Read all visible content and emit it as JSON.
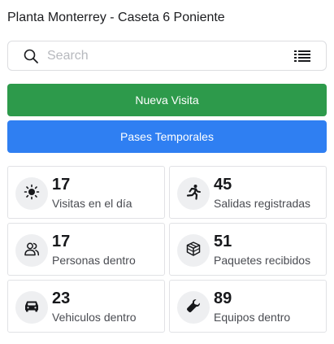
{
  "header": {
    "title": "Planta Monterrey - Caseta 6 Poniente"
  },
  "search": {
    "placeholder": "Search",
    "value": "",
    "icon": "search-icon",
    "list_icon": "list-icon"
  },
  "actions": {
    "new_visit_label": "Nueva Visita",
    "temp_passes_label": "Pases Temporales",
    "new_visit_color": "#2d9a4b",
    "temp_passes_color": "#2f7ff2"
  },
  "stats": [
    {
      "value": "17",
      "label": "Visitas en el día",
      "icon": "sun-icon"
    },
    {
      "value": "45",
      "label": "Salidas registradas",
      "icon": "running-person-icon"
    },
    {
      "value": "17",
      "label": "Personas dentro",
      "icon": "people-icon"
    },
    {
      "value": "51",
      "label": "Paquetes recibidos",
      "icon": "package-icon"
    },
    {
      "value": "23",
      "label": "Vehiculos dentro",
      "icon": "car-icon"
    },
    {
      "value": "89",
      "label": "Equipos dentro",
      "icon": "wrench-icon"
    }
  ]
}
